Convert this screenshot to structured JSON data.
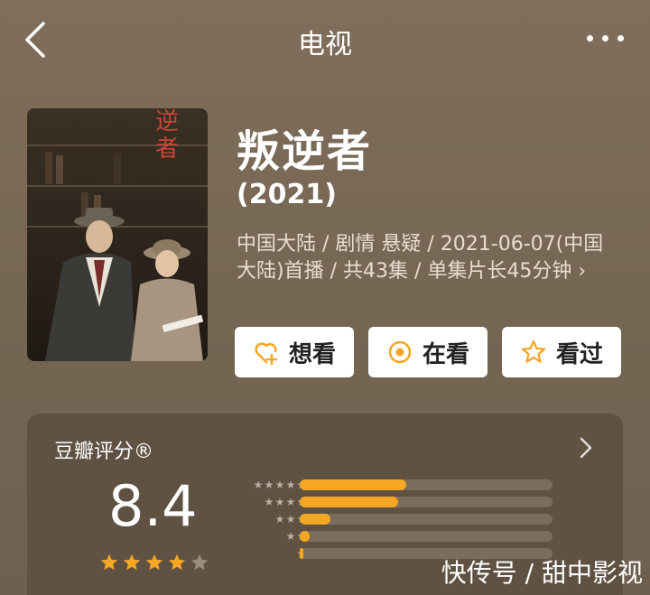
{
  "header": {
    "title": "电视"
  },
  "movie": {
    "title": "叛逆者",
    "year": "(2021)",
    "meta": "中国大陆 / 剧情 悬疑 / 2021-06-07(中国大陆)首播 / 共43集 / 单集片长45分钟 ›",
    "poster_text": "逆者"
  },
  "actions": {
    "want_label": "想看",
    "watching_label": "在看",
    "watched_label": "看过"
  },
  "rating": {
    "label": "豆瓣评分®",
    "score": "8.4",
    "stars_filled": 4,
    "stars_total": 5,
    "distribution": [
      {
        "stars": 5,
        "fraction": 0.42
      },
      {
        "stars": 4,
        "fraction": 0.39
      },
      {
        "stars": 3,
        "fraction": 0.12
      },
      {
        "stars": 2,
        "fraction": 0.04
      },
      {
        "stars": 1,
        "fraction": 0.01
      }
    ]
  },
  "watermark": "快传号 / 甜中影视",
  "colors": {
    "accent": "#f5a623",
    "background": "#7a6a58",
    "card": "#5f5243"
  }
}
